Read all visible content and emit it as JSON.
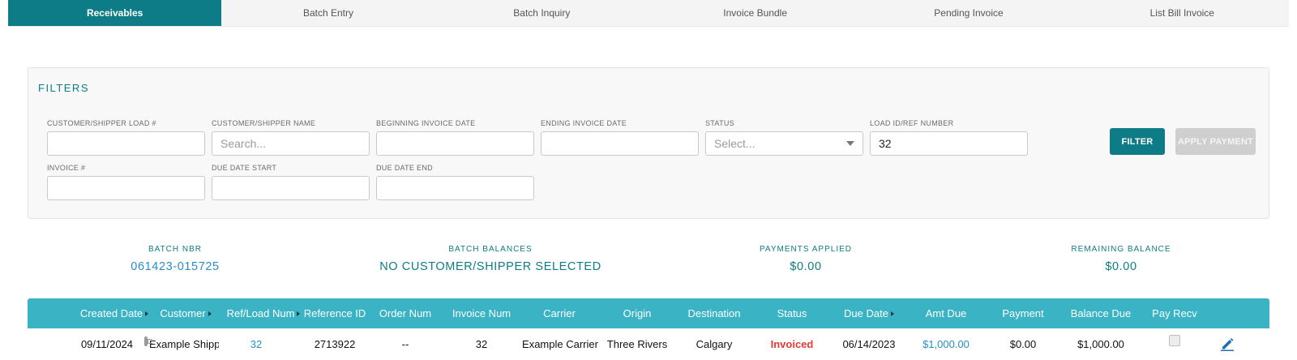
{
  "tabs": [
    {
      "label": "Receivables",
      "active": true
    },
    {
      "label": "Batch Entry"
    },
    {
      "label": "Batch Inquiry"
    },
    {
      "label": "Invoice Bundle"
    },
    {
      "label": "Pending Invoice"
    },
    {
      "label": "List Bill Invoice"
    }
  ],
  "filters": {
    "title": "FILTERS",
    "customer_load": {
      "label": "CUSTOMER/SHIPPER LOAD #",
      "value": ""
    },
    "customer_name": {
      "label": "CUSTOMER/SHIPPER NAME",
      "placeholder": "Search..."
    },
    "begin_invoice_date": {
      "label": "BEGINNING INVOICE DATE",
      "value": ""
    },
    "end_invoice_date": {
      "label": "ENDING INVOICE DATE",
      "value": ""
    },
    "status": {
      "label": "STATUS",
      "placeholder": "Select..."
    },
    "load_id": {
      "label": "LOAD ID/REF NUMBER",
      "value": "32"
    },
    "invoice_num": {
      "label": "INVOICE #",
      "value": ""
    },
    "due_start": {
      "label": "DUE DATE START",
      "value": ""
    },
    "due_end": {
      "label": "DUE DATE END",
      "value": ""
    },
    "filter_button": "FILTER",
    "apply_button": "APPLY PAYMENT"
  },
  "summary": {
    "batch_nbr": {
      "label": "BATCH NBR",
      "value": "061423-015725"
    },
    "batch_balances": {
      "label": "BATCH BALANCES",
      "value": "NO CUSTOMER/SHIPPER SELECTED"
    },
    "payments_applied": {
      "label": "PAYMENTS APPLIED",
      "value": "$0.00"
    },
    "remaining_balance": {
      "label": "REMAINING BALANCE",
      "value": "$0.00"
    }
  },
  "table": {
    "columns": [
      "Created Date",
      "Customer",
      "Ref/Load Num",
      "Reference ID",
      "Order Num",
      "Invoice Num",
      "Carrier",
      "Origin",
      "Destination",
      "Status",
      "Due Date",
      "Amt Due",
      "Payment",
      "Balance Due",
      "Pay Recv"
    ],
    "rows": [
      {
        "created_date": "09/11/2024",
        "customer": "Example Shipper",
        "ref_load": "32",
        "reference_id": "2713922",
        "order_num": "--",
        "invoice_num": "32",
        "carrier": "Example Carrier",
        "origin": "Three Rivers",
        "destination": "Calgary",
        "status": "Invoiced",
        "due_date": "06/14/2023",
        "amt_due": "$1,000.00",
        "payment": "$0.00",
        "balance_due": "$1,000.00"
      }
    ]
  },
  "colors": {
    "accent": "#0e7c86",
    "header": "#3ab3c4",
    "status_invoiced": "#e53935",
    "link": "#2a8cc7"
  },
  "icons": {
    "customer": "document-icon",
    "edit": "pencil-icon"
  }
}
